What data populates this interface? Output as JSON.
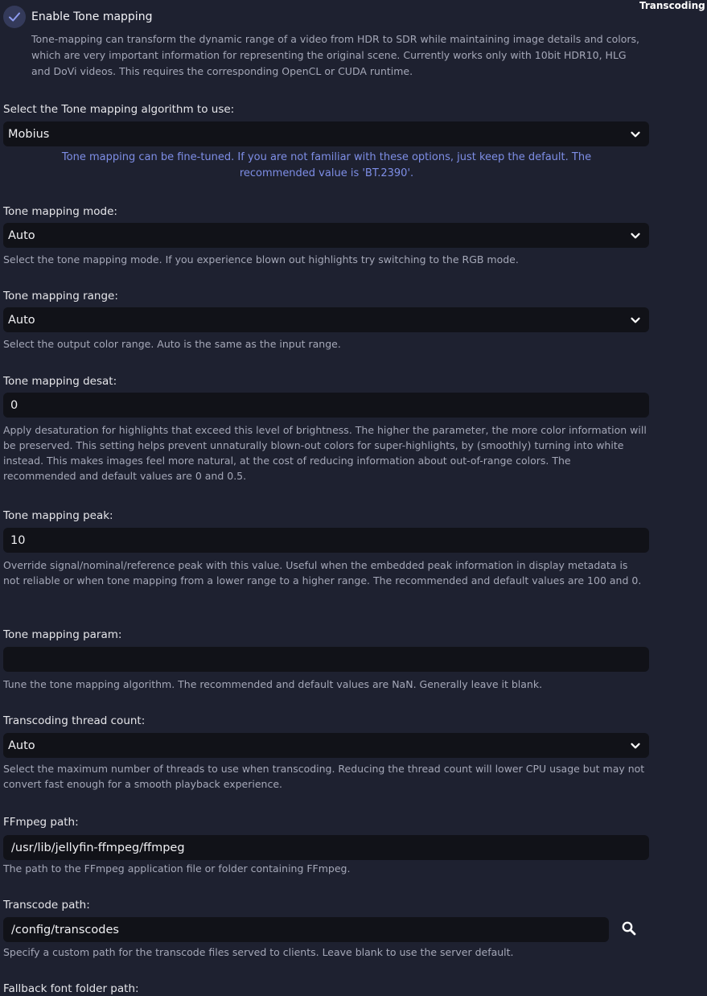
{
  "header": {
    "corner_title": "Transcoding"
  },
  "tone_mapping_toggle": {
    "label": "Enable Tone mapping",
    "checked": true,
    "description": "Tone-mapping can transform the dynamic range of a video from HDR to SDR while maintaining image details and colors, which are very important information for representing the original scene. Currently works only with 10bit HDR10, HLG and DoVi videos. This requires the corresponding OpenCL or CUDA runtime."
  },
  "algorithm": {
    "label": "Select the Tone mapping algorithm to use:",
    "value": "Mobius",
    "notice": "Tone mapping can be fine-tuned. If you are not familiar with these options, just keep the default. The recommended value is 'BT.2390'."
  },
  "mode": {
    "label": "Tone mapping mode:",
    "value": "Auto",
    "help": "Select the tone mapping mode. If you experience blown out highlights try switching to the RGB mode."
  },
  "range": {
    "label": "Tone mapping range:",
    "value": "Auto",
    "help": "Select the output color range. Auto is the same as the input range."
  },
  "desat": {
    "label": "Tone mapping desat:",
    "value": "0",
    "help": "Apply desaturation for highlights that exceed this level of brightness. The higher the parameter, the more color information will be preserved. This setting helps prevent unnaturally blown-out colors for super-highlights, by (smoothly) turning into white instead. This makes images feel more natural, at the cost of reducing information about out-of-range colors. The recommended and default values are 0 and 0.5."
  },
  "peak": {
    "label": "Tone mapping peak:",
    "value": "10",
    "help": "Override signal/nominal/reference peak with this value. Useful when the embedded peak information in display metadata is not reliable or when tone mapping from a lower range to a higher range. The recommended and default values are 100 and 0."
  },
  "param": {
    "label": "Tone mapping param:",
    "value": "",
    "help": "Tune the tone mapping algorithm. The recommended and default values are NaN. Generally leave it blank."
  },
  "thread_count": {
    "label": "Transcoding thread count:",
    "value": "Auto",
    "help": "Select the maximum number of threads to use when transcoding. Reducing the thread count will lower CPU usage but may not convert fast enough for a smooth playback experience."
  },
  "ffmpeg_path": {
    "label": "FFmpeg path:",
    "value": "/usr/lib/jellyfin-ffmpeg/ffmpeg",
    "help": "The path to the FFmpeg application file or folder containing FFmpeg."
  },
  "transcode_path": {
    "label": "Transcode path:",
    "value": "/config/transcodes",
    "help": "Specify a custom path for the transcode files served to clients. Leave blank to use the server default.",
    "button_icon": "search-icon"
  },
  "fallback_font": {
    "label": "Fallback font folder path:"
  },
  "colors": {
    "background": "#1e2130",
    "field": "#111218",
    "accent": "#7e8ee6",
    "muted_text": "#a5a8b8"
  }
}
